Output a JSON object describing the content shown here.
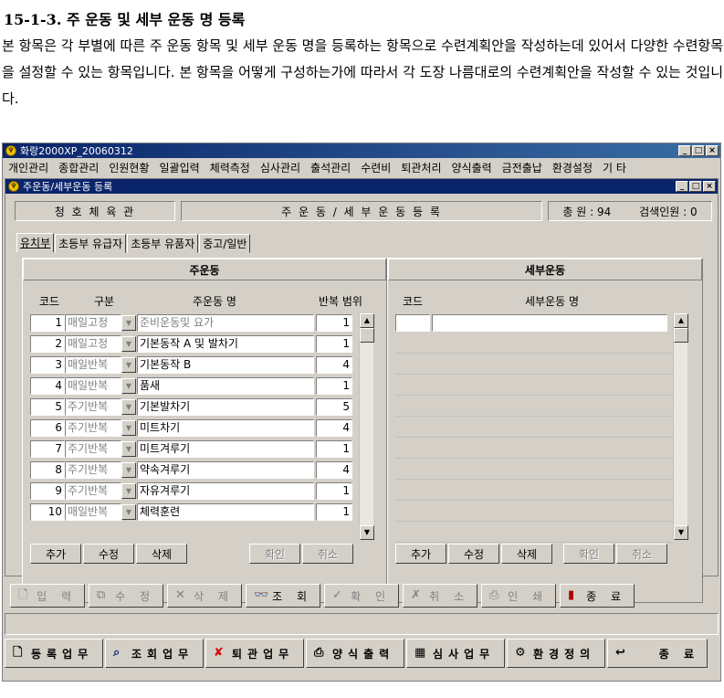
{
  "doc": {
    "title": "15-1-3. 주 운동 및 세부 운동 명 등록",
    "paragraph": "본 항목은 각 부별에 따른 주 운동 항목 및 세부 운동 명을 등록하는 항목으로 수련계획안을 작성하는데 있어서 다양한 수련항목을 설정할 수 있는 항목입니다. 본 항목을 어떻게 구성하는가에 따라서 각 도장 나름대로의 수련계획안을 작성할 수 있는 것입니다."
  },
  "app": {
    "title": "화랑2000XP_20060312",
    "menu": [
      "개인관리",
      "종합관리",
      "인원현황",
      "일괄입력",
      "체력측정",
      "심사관리",
      "출석관리",
      "수련비",
      "퇴관처리",
      "양식출력",
      "금전출납",
      "환경설정",
      "기 타"
    ]
  },
  "child": {
    "title": "주운동/세부운동 등록",
    "dojo": "청 호 체 육 관",
    "screen": "주 운 동 / 세 부 운 동  등 록",
    "total": "총 원 : 94",
    "found": "검색인원 : 0",
    "tabs": [
      "유치부",
      "초등부 유급자",
      "초등부 유품자",
      "중고/일반"
    ]
  },
  "main": {
    "header": "주운동",
    "cols": {
      "code": "코드",
      "type": "구분",
      "name": "주운동 명",
      "repeat": "반복 범위"
    },
    "rows": [
      {
        "code": "1",
        "type": "매일고정",
        "name": "준비운동및 요가",
        "repeat": "1",
        "name_grey": true
      },
      {
        "code": "2",
        "type": "매일고정",
        "name": "기본동작 A 및 발차기",
        "repeat": "1"
      },
      {
        "code": "3",
        "type": "매일반복",
        "name": "기본동작 B",
        "repeat": "4"
      },
      {
        "code": "4",
        "type": "매일반복",
        "name": "품새",
        "repeat": "1"
      },
      {
        "code": "5",
        "type": "주기반복",
        "name": "기본발차기",
        "repeat": "5"
      },
      {
        "code": "6",
        "type": "주기반복",
        "name": "미트차기",
        "repeat": "4"
      },
      {
        "code": "7",
        "type": "주기반복",
        "name": "미트겨루기",
        "repeat": "1"
      },
      {
        "code": "8",
        "type": "주기반복",
        "name": "약속겨루기",
        "repeat": "4"
      },
      {
        "code": "9",
        "type": "주기반복",
        "name": "자유겨루기",
        "repeat": "1"
      },
      {
        "code": "10",
        "type": "매일반복",
        "name": "체력훈련",
        "repeat": "1"
      }
    ],
    "buttons": [
      "추가",
      "수정",
      "삭제"
    ],
    "buttons_disabled": [
      "확인",
      "취소"
    ]
  },
  "detail": {
    "header": "세부운동",
    "cols": {
      "code": "코드",
      "name": "세부운동 명"
    },
    "buttons": [
      "추가",
      "수정",
      "삭제"
    ],
    "buttons_disabled": [
      "확인",
      "취소"
    ]
  },
  "toolbar": [
    {
      "label": "입 력",
      "icon": "new-doc-icon",
      "enabled": false
    },
    {
      "label": "수 정",
      "icon": "copy-doc-icon",
      "enabled": false
    },
    {
      "label": "삭 제",
      "icon": "x-icon",
      "enabled": false
    },
    {
      "label": "조 회",
      "icon": "binoculars-icon",
      "enabled": true
    },
    {
      "label": "확 인",
      "icon": "check-pen-icon",
      "enabled": false
    },
    {
      "label": "취 소",
      "icon": "cancel-icon",
      "enabled": false
    },
    {
      "label": "인 쇄",
      "icon": "printer-icon",
      "enabled": false
    },
    {
      "label": "종 료",
      "icon": "exit-door-icon",
      "enabled": true
    }
  ],
  "bottom": [
    {
      "label": "등록업무",
      "icon": "page-icon"
    },
    {
      "label": "조회업무",
      "icon": "search-icon"
    },
    {
      "label": "퇴관업무",
      "icon": "red-x-icon"
    },
    {
      "label": "양식출력",
      "icon": "printer-icon"
    },
    {
      "label": "심사업무",
      "icon": "calculator-icon"
    },
    {
      "label": "환경정의",
      "icon": "settings-person-icon"
    },
    {
      "label": "종 료",
      "icon": "exit-icon"
    }
  ]
}
